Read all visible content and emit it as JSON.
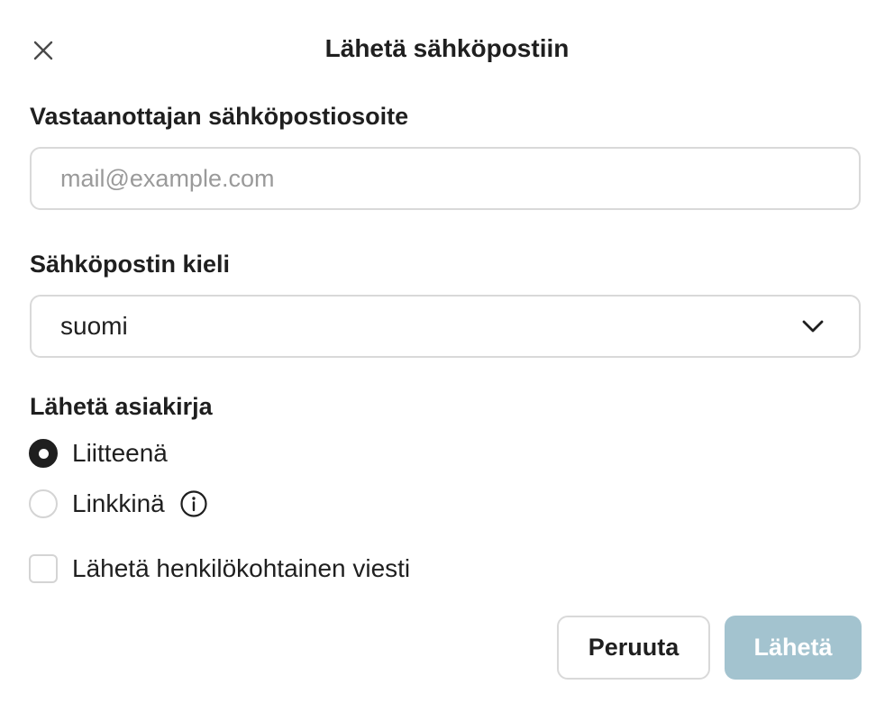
{
  "dialog": {
    "title": "Lähetä sähköpostiin",
    "close_icon": "close-icon"
  },
  "recipient": {
    "label": "Vastaanottajan sähköpostiosoite",
    "value": "",
    "placeholder": "mail@example.com"
  },
  "language": {
    "label": "Sähköpostin kieli",
    "selected": "suomi",
    "icon": "chevron-down-icon"
  },
  "send_as": {
    "label": "Lähetä asiakirja",
    "options": [
      {
        "label": "Liitteenä",
        "checked": true
      },
      {
        "label": "Linkkinä",
        "checked": false,
        "icon": "info-icon"
      }
    ]
  },
  "personal_message": {
    "label": "Lähetä henkilökohtainen viesti",
    "checked": false
  },
  "actions": {
    "cancel_label": "Peruuta",
    "send_label": "Lähetä",
    "send_color": "#a3c3cf"
  }
}
